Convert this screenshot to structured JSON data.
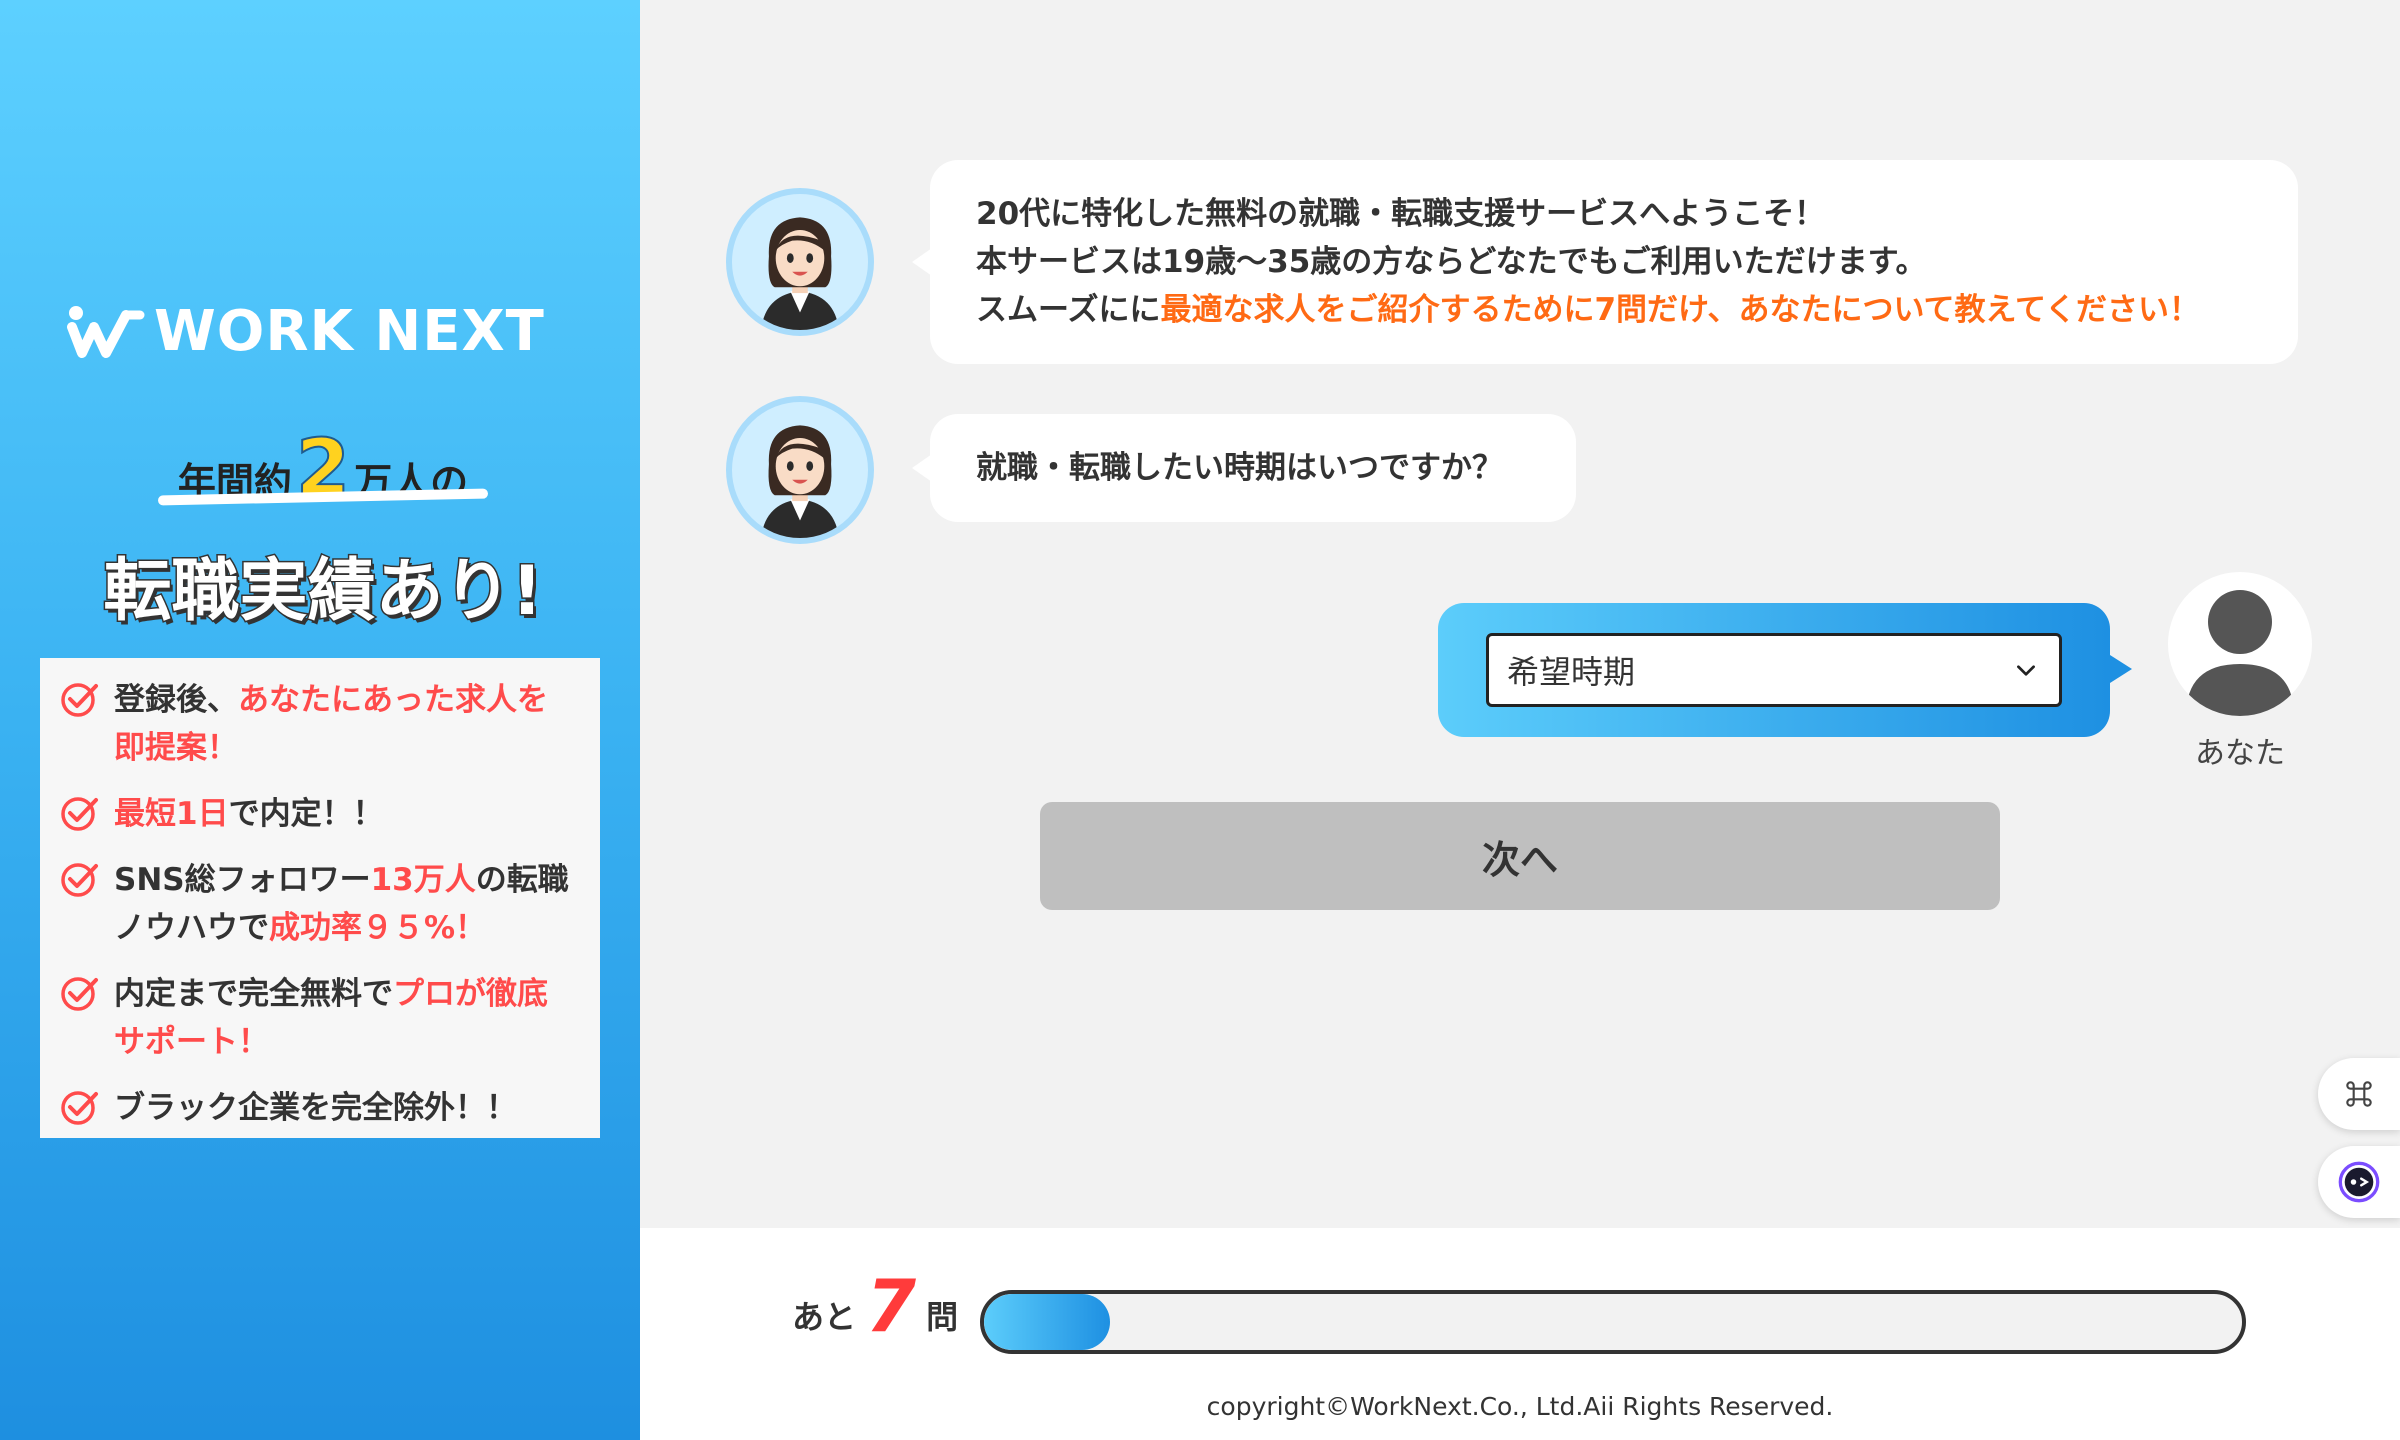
{
  "brand": {
    "logo_text": "WORK NEXT"
  },
  "sidebar": {
    "tagline_pre": "年間約",
    "tagline_num": "2",
    "tagline_post": "万人の",
    "tagline_main": "転職実績あり!",
    "features": [
      {
        "parts": [
          {
            "t": "登録後、",
            "hl": false
          },
          {
            "t": "あなたにあった求人を",
            "hl": true
          }
        ],
        "parts2": [
          {
            "t": "即提案！",
            "hl": true
          }
        ]
      },
      {
        "parts": [
          {
            "t": "最短1日",
            "hl": true
          },
          {
            "t": "で内定！！",
            "hl": false
          }
        ],
        "parts2": []
      },
      {
        "parts": [
          {
            "t": "SNS総フォロワー",
            "hl": false
          },
          {
            "t": "13万人",
            "hl": true
          },
          {
            "t": "の転職",
            "hl": false
          }
        ],
        "parts2": [
          {
            "t": "ノウハウで",
            "hl": false
          },
          {
            "t": "成功率９５%！",
            "hl": true
          }
        ]
      },
      {
        "parts": [
          {
            "t": "内定まで完全無料で",
            "hl": false
          },
          {
            "t": "プロが徹底",
            "hl": true
          }
        ],
        "parts2": [
          {
            "t": "サポート！",
            "hl": true
          }
        ]
      },
      {
        "parts": [
          {
            "t": "ブラック企業を完全除外！！",
            "hl": false
          }
        ],
        "parts2": []
      }
    ]
  },
  "chat": {
    "message1": {
      "line1": "20代に特化した無料の就職・転職支援サービスへようこそ！",
      "line2": "本サービスは19歳〜35歳の方ならどなたでもご利用いただけます。",
      "line3_plain": "スムーズにに",
      "line3_highlight": "最適な求人をご紹介するために7問だけ、あなたについて教えてください！"
    },
    "message2": "就職・転職したい時期はいつですか？",
    "answer_select": {
      "selected": "希望時期"
    },
    "user_label": "あなた",
    "next_button": "次へ"
  },
  "footer": {
    "remain_pre": "あと",
    "remain_num": "7",
    "remain_post": "問",
    "progress_fraction": 0.1,
    "copyright": "copyright©WorkNext.Co., Ltd.Aii Rights Reserved."
  },
  "icons": {
    "check": "check-circle-icon",
    "chevron": "chevron-down-icon",
    "user": "user-silhouette-icon",
    "command": "command-icon",
    "assistant": "assistant-bot-icon"
  },
  "colors": {
    "accent_blue": "#1e90e2",
    "highlight_red": "#ff4b4b",
    "highlight_orange": "#ff6a14",
    "button_gray": "#bfbfbf"
  }
}
